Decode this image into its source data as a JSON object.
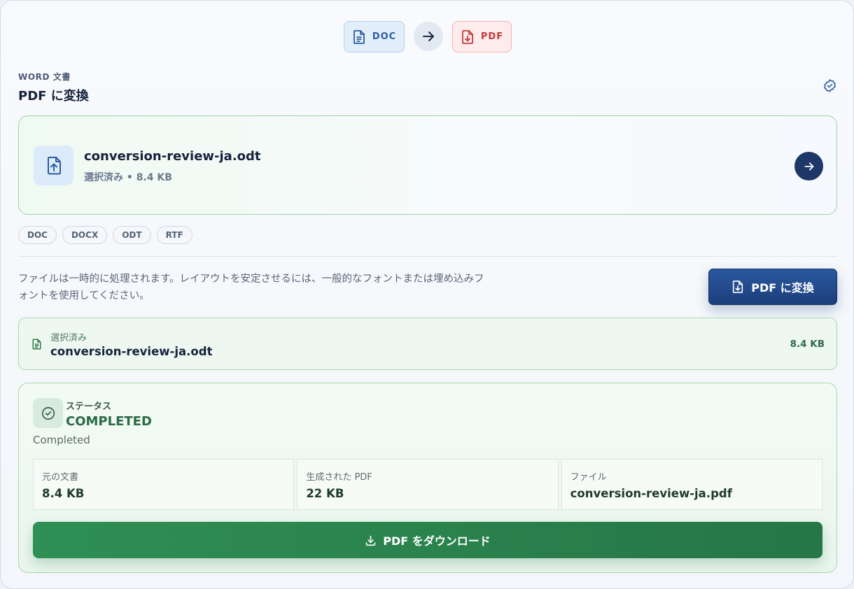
{
  "formats": {
    "source": "DOC",
    "target": "PDF"
  },
  "header": {
    "eyebrow": "WORD 文書",
    "title": "PDF に変換"
  },
  "file": {
    "name": "conversion-review-ja.odt",
    "meta": "選択済み • 8.4 KB"
  },
  "accepted_types": [
    "DOC",
    "DOCX",
    "ODT",
    "RTF"
  ],
  "notice": "ファイルは一時的に処理されます。レイアウトを安定させるには、一般的なフォントまたは埋め込みフォントを使用してください。",
  "convert_button": "PDF に変換",
  "selected": {
    "label": "選択済み",
    "name": "conversion-review-ja.odt",
    "size": "8.4 KB"
  },
  "status": {
    "label": "ステータス",
    "value": "COMPLETED",
    "description": "Completed",
    "stats": [
      {
        "label": "元の文書",
        "value": "8.4 KB"
      },
      {
        "label": "生成された PDF",
        "value": "22 KB"
      },
      {
        "label": "ファイル",
        "value": "conversion-review-ja.pdf"
      }
    ]
  },
  "download_button": "PDF をダウンロード",
  "colors": {
    "primary": "#1d3767",
    "success": "#2f8f54",
    "doc_accent": "#2a5e9e",
    "pdf_accent": "#c23a3a"
  }
}
